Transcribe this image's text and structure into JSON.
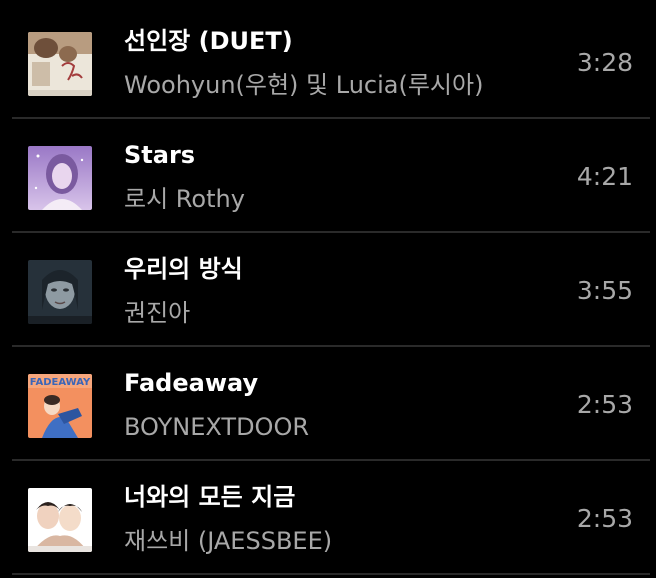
{
  "tracks": [
    {
      "title": "선인장 (DUET)",
      "artist": "Woohyun(우현) 및 Lucia(루시아)",
      "duration": "3:28",
      "cover": "album-art-cactus",
      "cover_colors": [
        "#e9e2d6",
        "#8c6a4f"
      ]
    },
    {
      "title": "Stars",
      "artist": "로시 Rothy",
      "duration": "4:21",
      "cover": "album-art-stars",
      "cover_colors": [
        "#b79ad6",
        "#6a4a8f"
      ]
    },
    {
      "title": "우리의 방식",
      "artist": "권진아",
      "duration": "3:55",
      "cover": "album-art-portrait",
      "cover_colors": [
        "#2f3a44",
        "#7d8a92"
      ]
    },
    {
      "title": "Fadeaway",
      "artist": "BOYNEXTDOOR",
      "duration": "2:53",
      "cover": "album-art-fadeaway",
      "cover_colors": [
        "#f28a5c",
        "#3b66b8"
      ]
    },
    {
      "title": "너와의 모든 지금",
      "artist": "재쓰비 (JAESSBEE)",
      "duration": "2:53",
      "cover": "album-art-duo",
      "cover_colors": [
        "#ffffff",
        "#c8a48e"
      ]
    }
  ]
}
